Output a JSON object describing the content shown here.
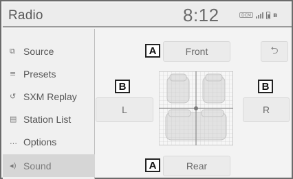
{
  "header": {
    "title": "Radio",
    "clock": "8:12",
    "dcm_label": "DCM",
    "signal_icon": "signal-bars-icon",
    "battery_icon": "battery-icon",
    "bluetooth_icon": "bluetooth-icon"
  },
  "sidebar": {
    "items": [
      {
        "label": "Source",
        "icon": "source-icon",
        "glyph": "⧉"
      },
      {
        "label": "Presets",
        "icon": "presets-icon",
        "glyph": "≡"
      },
      {
        "label": "SXM Replay",
        "icon": "replay-icon",
        "glyph": "↺"
      },
      {
        "label": "Station List",
        "icon": "station-list-icon",
        "glyph": "▤"
      },
      {
        "label": "Options",
        "icon": "options-icon",
        "glyph": "…"
      },
      {
        "label": "Sound",
        "icon": "sound-icon",
        "glyph": "◂)"
      }
    ],
    "active_index": 5
  },
  "balance": {
    "front_label": "Front",
    "rear_label": "Rear",
    "left_label": "L",
    "right_label": "R",
    "back_glyph": "⮌"
  },
  "callouts": {
    "a_top": "A",
    "a_bottom": "A",
    "b_left": "B",
    "b_right": "B"
  },
  "colors": {
    "background": "#f3f3f3",
    "button": "#ebebeb",
    "active_item": "#d6d6d6",
    "text": "#555555"
  }
}
